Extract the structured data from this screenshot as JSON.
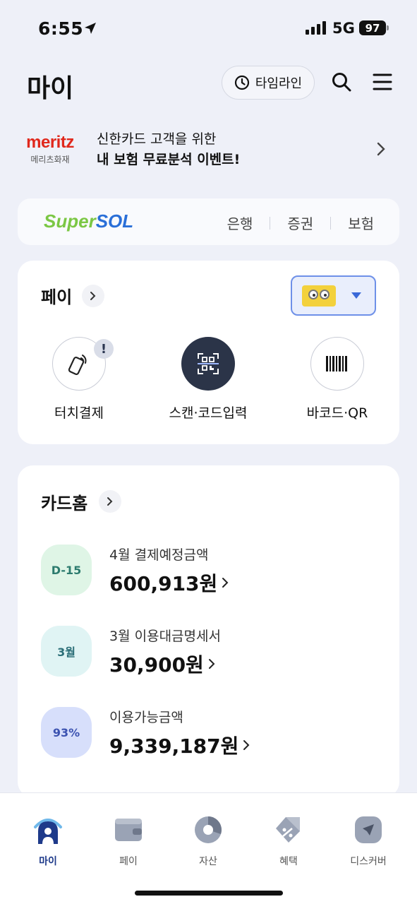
{
  "status": {
    "time": "6:55",
    "network": "5G",
    "battery": "97"
  },
  "header": {
    "title": "마이",
    "timeline_label": "타임라인"
  },
  "banner": {
    "logo_text": "meritz",
    "logo_sub": "메리츠화재",
    "line1": "신한카드 고객을 위한",
    "line2": "내 보험 무료분석 이벤트!"
  },
  "supersol": {
    "logo_super": "Super",
    "logo_sol": "SOL",
    "links": [
      "은행",
      "증권",
      "보험"
    ]
  },
  "pay": {
    "title": "페이",
    "alert": "!",
    "actions": [
      {
        "label": "터치결제",
        "icon": "touch-pay-icon"
      },
      {
        "label": "스캔·코드입력",
        "icon": "qr-scan-icon"
      },
      {
        "label": "바코드·QR",
        "icon": "barcode-icon"
      }
    ]
  },
  "cardhome": {
    "title": "카드홈",
    "rows": [
      {
        "badge": "D-15",
        "label": "4월 결제예정금액",
        "amount": "600,913원",
        "bg": "#dff5e6",
        "fg": "#2c7b6e"
      },
      {
        "badge": "3월",
        "label": "3월 이용대금명세서",
        "amount": "30,900원",
        "bg": "#e0f4f4",
        "fg": "#2c6f78"
      },
      {
        "badge": "93%",
        "label": "이용가능금액",
        "amount": "9,339,187원",
        "bg": "#d7dffb",
        "fg": "#3b52b0"
      }
    ]
  },
  "nav": {
    "items": [
      {
        "label": "마이",
        "active": true
      },
      {
        "label": "페이",
        "active": false
      },
      {
        "label": "자산",
        "active": false
      },
      {
        "label": "혜택",
        "active": false
      },
      {
        "label": "디스커버",
        "active": false
      }
    ]
  },
  "colors": {
    "accent": "#1e3a8a",
    "meritz_red": "#e0281c",
    "sol_green": "#7bc744",
    "sol_blue": "#2a6fd8"
  }
}
